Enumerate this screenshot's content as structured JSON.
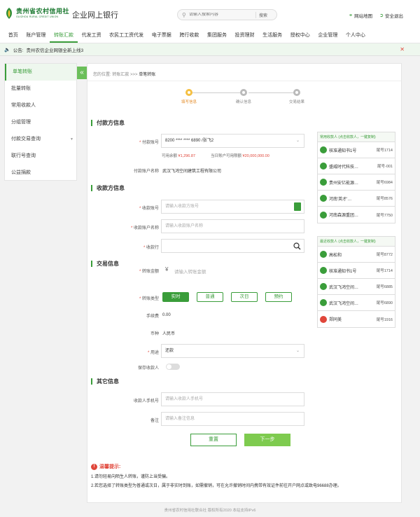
{
  "header": {
    "logo_cn": "贵州省农村信用社",
    "logo_en": "GUIZHOU RURAL CREDIT UNION",
    "title": "企业网上银行",
    "search_placeholder": "请输入搜索内容",
    "search_btn": "搜索",
    "links": [
      "网站地图",
      "安全退出"
    ]
  },
  "nav": {
    "items": [
      "首页",
      "账户管理",
      "转账汇款",
      "代发工资",
      "农民工工资代发",
      "电子票据",
      "跨行收款",
      "集团服务",
      "投资理财",
      "生活服务",
      "授权中心",
      "企业管理",
      "个人中心"
    ],
    "active_index": 2
  },
  "notice": {
    "label": "公告:",
    "text": "贵州农信企业网银全新上线3"
  },
  "sidebar": {
    "items": [
      {
        "label": "单笔转账"
      },
      {
        "label": "批量转账"
      },
      {
        "label": "常用收款人"
      },
      {
        "label": "分组管理"
      },
      {
        "label": "付款交易查询"
      },
      {
        "label": "联行号查询"
      },
      {
        "label": "公益捐款"
      }
    ]
  },
  "breadcrumb": {
    "prefix": "您的位置:",
    "parent": "转账汇款",
    "sep": ">>>",
    "current": "单笔转账"
  },
  "steps": [
    "填写信息",
    "确认信息",
    "交易结果"
  ],
  "payer": {
    "title": "付款方信息",
    "account_label": "付款账号",
    "account_value": "8200 **** **** 6890 /张飞2",
    "balance_label": "可用余额",
    "balance_value": "¥1,296.87",
    "limit_label": "当日账户可用限额",
    "limit_value": "¥20,000,000.00",
    "name_label": "付款账户名称",
    "name_value": "武汉飞鸿空间建筑工程有限公司"
  },
  "payee": {
    "title": "收款方信息",
    "account_label": "收款账号",
    "account_placeholder": "请输入收款方账号",
    "name_label": "收款账户名称",
    "name_placeholder": "请输入收款账户名称",
    "bank_label": "收款行"
  },
  "trade": {
    "title": "交易信息",
    "amount_label": "转账金额",
    "amount_placeholder": "请输入转账金额",
    "type_label": "转账类型",
    "types": [
      "实时",
      "普通",
      "次日",
      "预约"
    ],
    "fee_label": "手续费",
    "fee_value": "0.00",
    "currency_label": "币种",
    "currency_value": "人民币",
    "purpose_label": "用途",
    "purpose_value": "还款",
    "save_label": "保存收款人"
  },
  "other": {
    "title": "其它信息",
    "phone_label": "收款人手机号",
    "phone_placeholder": "请输入收款人手机号",
    "memo_label": "备注",
    "memo_placeholder": "请输入备注信息"
  },
  "buttons": {
    "reset": "重置",
    "next": "下一步"
  },
  "tips": {
    "title": "温馨提示:",
    "lines": [
      "1.请勿轻易向陌生人转账，谨防上当受骗。",
      "2.若您选择了转账类型为普通或次日，属于非实时到账，如需撤销，可在允许撤销时间内携带有效证件前往开户网点或致电96688办理。"
    ]
  },
  "frequent_payees": {
    "head": "常用收款人   (点击收款人，一键复制)",
    "rows": [
      {
        "name": "核准通知书1号",
        "tail": "尾号1714",
        "color": "#3a9d3a"
      },
      {
        "name": "盛威时代科技…",
        "tail": "尾号-001",
        "color": "#3a9d3a"
      },
      {
        "name": "贵州安亿能源…",
        "tail": "尾号6984",
        "color": "#3a9d3a"
      },
      {
        "name": "河南'英才'…",
        "tail": "尾号8576",
        "color": "#3a9d3a"
      },
      {
        "name": "河南森源重团…",
        "tail": "尾号7750",
        "color": "#3a9d3a"
      }
    ]
  },
  "recent_payees": {
    "head": "最近收款人   (点击收款人，一键复制)",
    "rows": [
      {
        "name": "高松和",
        "tail": "尾号8772",
        "color": "#3a9d3a"
      },
      {
        "name": "核准通知书1号",
        "tail": "尾号1714",
        "color": "#3a9d3a"
      },
      {
        "name": "武汉飞鸿空间…",
        "tail": "尾号6885",
        "color": "#3a9d3a"
      },
      {
        "name": "武汉飞鸿空间…",
        "tail": "尾号6890",
        "color": "#3a9d3a"
      },
      {
        "name": "郑同美",
        "tail": "尾号1916",
        "color": "#e0463a"
      }
    ]
  },
  "footer": "贵州省农村信用社联合社 版权所有2020   本站支持IPv6"
}
